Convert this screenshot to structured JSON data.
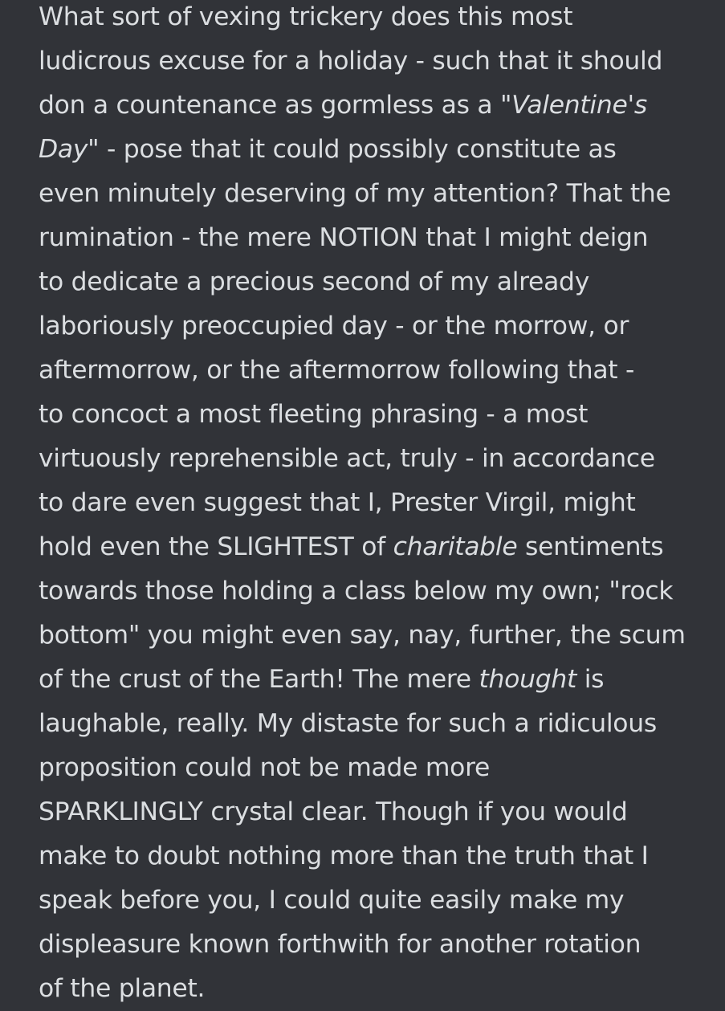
{
  "message": {
    "lines": [
      {
        "text": "What sort of vexing trickery does this most"
      },
      {
        "text": "ludicrous excuse for a holiday - such that it should"
      },
      {
        "before": "don a countenance as gormless as a ",
        "em": "\"Valentine's",
        "after": ""
      },
      {
        "before": "",
        "em": "Day\"",
        "after": " - pose that it could possibly constitute as"
      },
      {
        "text": "even minutely deserving of my attention? That the"
      },
      {
        "text": "rumination - the mere NOTION that I might deign"
      },
      {
        "text": "to dedicate a precious second of my already"
      },
      {
        "text": "laboriously preoccupied day - or the morrow, or"
      },
      {
        "text": "aftermorrow, or the aftermorrow following that -"
      },
      {
        "text": "to concoct a most fleeting phrasing - a most"
      },
      {
        "text": "virtuously reprehensible act, truly - in accordance"
      },
      {
        "text": "to dare even suggest that I, Prester Virgil, might"
      },
      {
        "before": "hold even the SLIGHTEST of ",
        "em": "charitable",
        "after": " sentiments"
      },
      {
        "text": "towards those holding a class below my own; \"rock"
      },
      {
        "text": "bottom\" you might even say, nay, further, the scum"
      },
      {
        "before": "of the crust of the Earth! The mere ",
        "em": "thought",
        "after": " is"
      },
      {
        "text": "laughable, really. My distaste for such a ridiculous"
      },
      {
        "text": "proposition could not be made more"
      },
      {
        "text": "SPARKLINGLY crystal clear. Though if you would"
      },
      {
        "text": "make to doubt nothing more than the truth that I"
      },
      {
        "text": "speak before you, I could quite easily make my"
      },
      {
        "text": "displeasure known forthwith for another rotation"
      },
      {
        "text": "of the planet."
      }
    ]
  }
}
